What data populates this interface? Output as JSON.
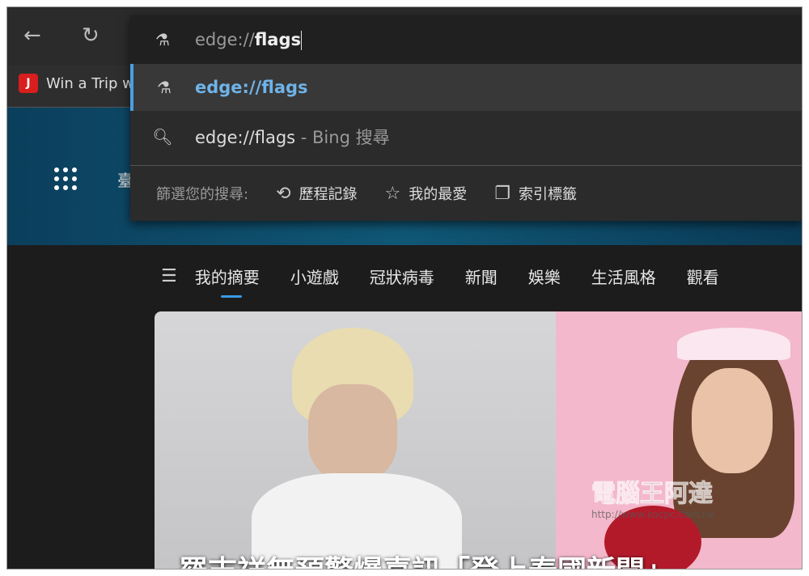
{
  "toolbar": {
    "back_icon": "arrow-left-icon",
    "refresh_icon": "refresh-icon"
  },
  "bookmarks": [
    {
      "label": "Win a Trip w",
      "favicon": "jal-logo"
    }
  ],
  "banner": {
    "text": "臺"
  },
  "address_bar": {
    "typed_prefix": "edge://",
    "typed_bold": "flags",
    "icon": "flask-icon"
  },
  "suggestions": [
    {
      "icon": "flask-icon",
      "text": "edge://flags",
      "highlighted": true
    },
    {
      "icon": "search-icon",
      "text": "edge://flags",
      "suffix": " - Bing 搜尋"
    }
  ],
  "filter": {
    "label": "篩選您的搜尋:",
    "options": [
      {
        "icon": "history-icon",
        "label": "歷程記錄"
      },
      {
        "icon": "star-icon",
        "label": "我的最愛"
      },
      {
        "icon": "tabs-icon",
        "label": "索引標籤"
      }
    ]
  },
  "nav": {
    "tabs": [
      "我的摘要",
      "小遊戲",
      "冠狀病毒",
      "新聞",
      "娛樂",
      "生活風格",
      "觀看"
    ],
    "active": 0
  },
  "card": {
    "headline": "羅志祥無預警爆喜訊「登上泰國新聞」"
  },
  "watermark": {
    "title": "電腦王阿達",
    "url": "http://www.kocpc.com.tw"
  },
  "colors": {
    "accent": "#4a9fe0",
    "suggestion_text": "#6fb3e8"
  }
}
